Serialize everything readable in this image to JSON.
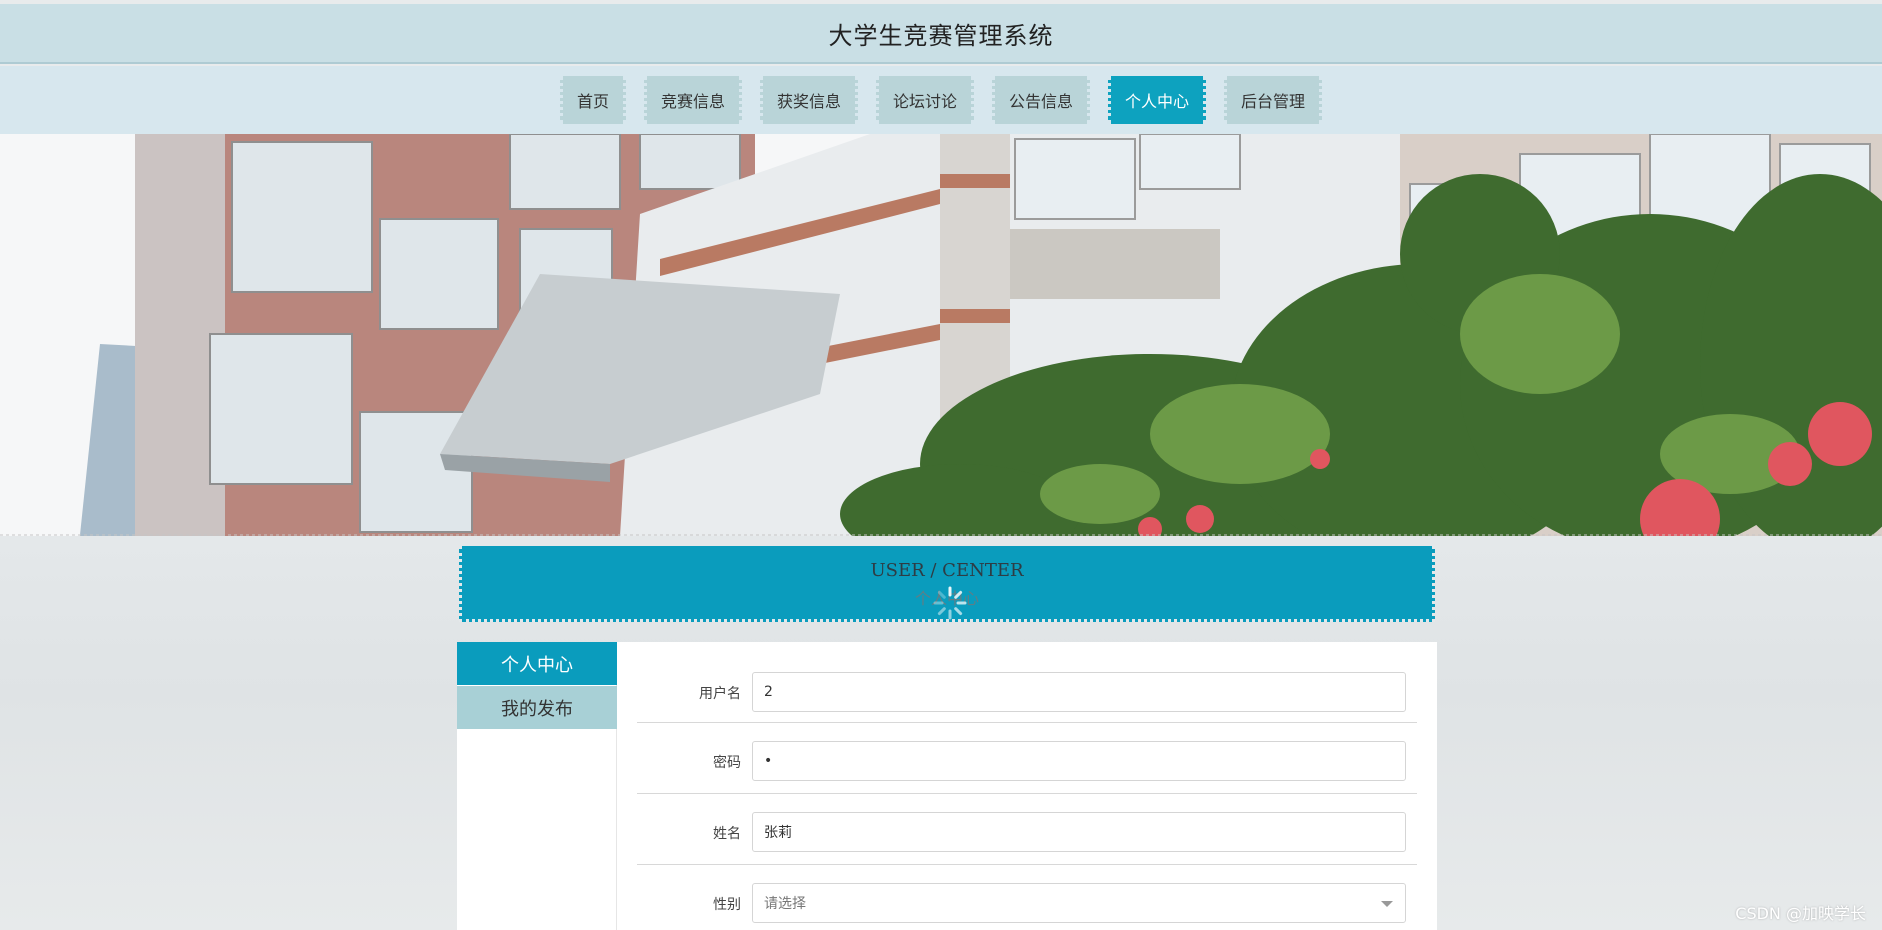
{
  "site": {
    "title": "大学生竞赛管理系统"
  },
  "nav": {
    "items": [
      {
        "label": "首页",
        "active": false
      },
      {
        "label": "竞赛信息",
        "active": false
      },
      {
        "label": "获奖信息",
        "active": false
      },
      {
        "label": "论坛讨论",
        "active": false
      },
      {
        "label": "公告信息",
        "active": false
      },
      {
        "label": "个人中心",
        "active": true
      },
      {
        "label": "后台管理",
        "active": false
      }
    ]
  },
  "section": {
    "title_en": "USER / CENTER",
    "title_cn": "个人中心"
  },
  "sidebar": {
    "items": [
      {
        "label": "个人中心",
        "active": true
      },
      {
        "label": "我的发布",
        "active": false
      }
    ]
  },
  "form": {
    "username": {
      "label": "用户名",
      "value": "2"
    },
    "password": {
      "label": "密码",
      "value": "•"
    },
    "name": {
      "label": "姓名",
      "value": "张莉"
    },
    "gender": {
      "label": "性别",
      "placeholder": "请选择"
    }
  },
  "watermark": "CSDN @加映学长",
  "colors": {
    "accent": "#0a9cbd",
    "header": "#c9dfe5",
    "nav_bg": "#d7e7ee",
    "tab_bg": "#b9d4d8"
  }
}
